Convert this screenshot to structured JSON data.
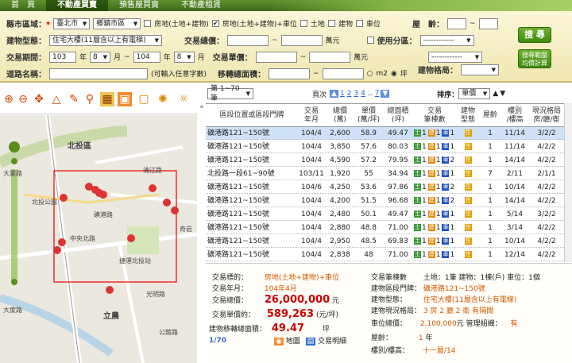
{
  "nav": {
    "tabs": [
      {
        "label": "首　頁",
        "active": false
      },
      {
        "label": "不動產買賣",
        "active": true
      },
      {
        "label": "預售屋買賣",
        "active": false
      },
      {
        "label": "不動產租賃",
        "active": false
      }
    ]
  },
  "search": {
    "city_label": "縣市區域：",
    "city_value": "臺北市",
    "district_value": "鄉鎮市區",
    "opt_land_building": "房地(土地+建物)",
    "opt_land_building_car": "房地(土地+建物)+車位",
    "opt_land": "土地",
    "opt_building": "建物",
    "opt_car": "車位",
    "age_label": "屋　齡：",
    "age_sep": "~",
    "type_label": "建物型態：",
    "type_value": "住宅大樓(11層含以上有電梯)",
    "total_price_label": "交易總價：",
    "total_unit": "萬元",
    "use_zone_label": "使用分區：",
    "period_label": "交易期間：",
    "year_from": "103",
    "month_from": "8",
    "year_to": "104",
    "month_to": "8",
    "year_text": "年",
    "month_text": "月",
    "range_sep": "~",
    "unit_price_label": "交易單價：",
    "unit_price_unit": "萬元",
    "road_label": "道路名稱：",
    "road_hint": "(可輸入任意字數)",
    "area_label": "移轉總面積：",
    "area_unit_m2": "m2",
    "area_unit_ping": "坪",
    "layout_label": "建物格局：",
    "search_button": "搜 尋",
    "avg_button_l1": "搜尋範圍",
    "avg_button_l2": "均價計算"
  },
  "pager": {
    "range": "第 1~70 筆",
    "pages_label": "頁次",
    "pages": [
      "1",
      "2",
      "3",
      "4",
      "..",
      "7"
    ],
    "sort_label": "排序：",
    "sort_value": "單價"
  },
  "table": {
    "headers": [
      {
        "l1": "區段位置或區段門牌",
        "l2": ""
      },
      {
        "l1": "交易",
        "l2": "年月"
      },
      {
        "l1": "總價",
        "l2": "(萬)"
      },
      {
        "l1": "單價",
        "l2": "(萬/坪)"
      },
      {
        "l1": "總面積",
        "l2": "(坪)"
      },
      {
        "l1": "交易",
        "l2": "筆棟數"
      },
      {
        "l1": "建物",
        "l2": "型態"
      },
      {
        "l1": "屋齡",
        "l2": ""
      },
      {
        "l1": "樓別",
        "l2": "/樓高"
      },
      {
        "l1": "現況格局",
        "l2": "房/廳/衛"
      }
    ],
    "rows": [
      {
        "addr": "礦港路121~150號",
        "date": "104/4",
        "total": "2,600",
        "unit": "58.9",
        "area": "49.47",
        "land": "1",
        "bld": "1",
        "car": "1",
        "age": "1",
        "floor": "11/14",
        "layout": "3/2/2"
      },
      {
        "addr": "礦港路121~150號",
        "date": "104/4",
        "total": "3,850",
        "unit": "57.6",
        "area": "80.03",
        "land": "1",
        "bld": "1",
        "car": "1",
        "age": "1",
        "floor": "11/14",
        "layout": "4/2/2"
      },
      {
        "addr": "礦港路121~150號",
        "date": "104/4",
        "total": "4,590",
        "unit": "57.2",
        "area": "79.95",
        "land": "1",
        "bld": "1",
        "car": "2",
        "age": "1",
        "floor": "14/14",
        "layout": "4/2/2"
      },
      {
        "addr": "北投路一段61~90號",
        "date": "103/11",
        "total": "1,920",
        "unit": "55",
        "area": "34.94",
        "land": "1",
        "bld": "1",
        "car": "1",
        "age": "7",
        "floor": "2/11",
        "layout": "2/1/1"
      },
      {
        "addr": "礦港路121~150號",
        "date": "104/6",
        "total": "4,250",
        "unit": "53.6",
        "area": "97.86",
        "land": "1",
        "bld": "1",
        "car": "2",
        "age": "1",
        "floor": "10/14",
        "layout": "4/2/2"
      },
      {
        "addr": "礦港路121~150號",
        "date": "104/4",
        "total": "4,200",
        "unit": "51.5",
        "area": "96.68",
        "land": "1",
        "bld": "1",
        "car": "2",
        "age": "1",
        "floor": "14/14",
        "layout": "4/2/2"
      },
      {
        "addr": "礦港路121~150號",
        "date": "104/4",
        "total": "2,480",
        "unit": "50.1",
        "area": "49.47",
        "land": "1",
        "bld": "1",
        "car": "1",
        "age": "1",
        "floor": "5/14",
        "layout": "3/2/2"
      },
      {
        "addr": "礦港路121~150號",
        "date": "104/4",
        "total": "2,880",
        "unit": "48.8",
        "area": "71.00",
        "land": "1",
        "bld": "1",
        "car": "1",
        "age": "1",
        "floor": "3/14",
        "layout": "4/2/2"
      },
      {
        "addr": "礦港路121~150號",
        "date": "104/4",
        "total": "2,950",
        "unit": "48.5",
        "area": "69.83",
        "land": "1",
        "bld": "1",
        "car": "1",
        "age": "1",
        "floor": "10/14",
        "layout": "4/2/2"
      },
      {
        "addr": "礦港路121~150號",
        "date": "104/4",
        "total": "2,838",
        "unit": "48",
        "area": "71.00",
        "land": "1",
        "bld": "1",
        "car": "1",
        "age": "1",
        "floor": "12/14",
        "layout": "4/2/2"
      }
    ],
    "badge_land": "土",
    "badge_bld": "建",
    "badge_car": "車",
    "house_icon": "住"
  },
  "detail": {
    "target_label": "交易標的：",
    "target_value": "房地(土地+建物)+車位",
    "date_label": "交易年月：",
    "date_value": "104年4月",
    "total_label": "交易總價：",
    "total_value": "26,000,000",
    "total_unit": "元",
    "unit_label": "交易單價約：",
    "unit_value": "589,263",
    "unit_unit": "(元/坪)",
    "area_label": "建物移轉總面積：",
    "area_value": "49.47",
    "area_unit": "坪",
    "count_label": "交易筆棟數",
    "count_value": "土地：1筆 建物：1棟(戶) 車位：1個",
    "addr_label": "建物區段門牌：",
    "addr_value": "礦港路121~150號",
    "type_label": "建物型態：",
    "type_value": "住宅大樓(11層含以上有電梯)",
    "layout_label": "建物現況格局：",
    "layout_value": "3 房 2 廳 2 衛 有隔間",
    "car_label": "車位總價：",
    "car_value": "2,100,000",
    "car_unit": "元",
    "mgmt_label": "管理組織：",
    "mgmt_value": "有",
    "age_label": "屋齡：",
    "age_value": "1",
    "age_unit": "年",
    "floor_label": "樓別/樓高：",
    "floor_value": "十一層/14",
    "index": "1/70",
    "map_link": "地圖",
    "detail_link": "交易明細"
  },
  "map": {
    "labels": [
      "北投區",
      "大業路",
      "磺港路",
      "捷運北投站",
      "中央北路",
      "北投公園",
      "立農",
      "光明路",
      "大度路",
      "奇岩",
      "清江路",
      "公館路"
    ]
  }
}
